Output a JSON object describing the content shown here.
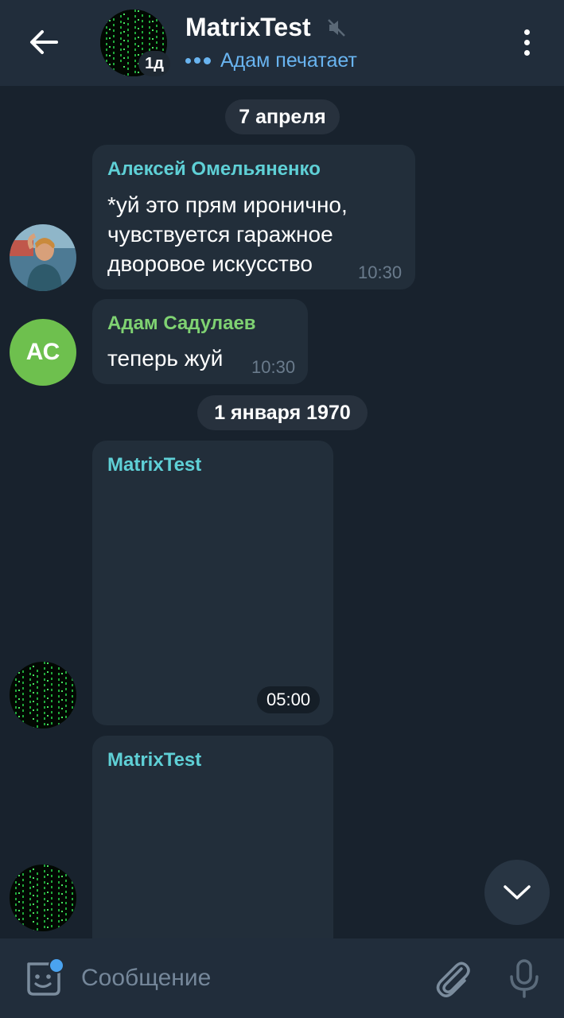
{
  "header": {
    "chat_title": "MatrixTest",
    "badge": "1д",
    "typing_status": "Адам печатает",
    "icons": {
      "back": "arrow-left-icon",
      "mute": "muted-speaker-icon",
      "menu": "more-vertical-icon"
    }
  },
  "dates": {
    "first": "7 апреля",
    "second": "1 января 1970"
  },
  "messages": [
    {
      "sender": "Алексей Омельяненко",
      "sender_color": "#5fd0d6",
      "lines": [
        "*уй это прям иронично,",
        "чувствуется гаражное",
        "дворовое искусство"
      ],
      "time": "10:30"
    },
    {
      "sender": "Адам Садулаев",
      "sender_color": "#7fd272",
      "avatar_initials": "АС",
      "lines": [
        "теперь жуй"
      ],
      "time": "10:30"
    },
    {
      "sender": "MatrixTest",
      "sender_color": "#5fd0d6",
      "time": "05:00"
    },
    {
      "sender": "MatrixTest",
      "sender_color": "#5fd0d6"
    }
  ],
  "input": {
    "placeholder": "Сообщение",
    "icons": {
      "sticker": "sticker-icon",
      "attach": "paperclip-icon",
      "mic": "microphone-icon"
    }
  },
  "scroll_down_icon": "chevron-down-icon",
  "colors": {
    "background": "#18222d",
    "header": "#212d3b",
    "bubble": "#222e3a",
    "accent_blue": "#69b4f0"
  }
}
